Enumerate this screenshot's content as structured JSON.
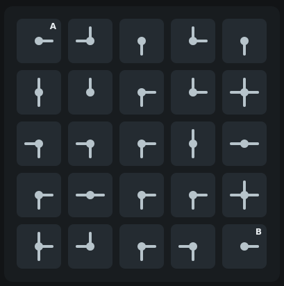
{
  "colors": {
    "background": "#121416",
    "board": "#181c1f",
    "tile": "#242b31",
    "pipe": "#b7c4cb",
    "label": "#e7ecef"
  },
  "grid": {
    "rows": 5,
    "cols": 5,
    "tiles": [
      {
        "row": 0,
        "col": 0,
        "connections": [
          "right"
        ],
        "label": "A"
      },
      {
        "row": 0,
        "col": 1,
        "connections": [
          "up",
          "left"
        ],
        "label": ""
      },
      {
        "row": 0,
        "col": 2,
        "connections": [
          "down"
        ],
        "label": ""
      },
      {
        "row": 0,
        "col": 3,
        "connections": [
          "up",
          "right"
        ],
        "label": ""
      },
      {
        "row": 0,
        "col": 4,
        "connections": [
          "down"
        ],
        "label": ""
      },
      {
        "row": 1,
        "col": 0,
        "connections": [
          "up",
          "down"
        ],
        "label": ""
      },
      {
        "row": 1,
        "col": 1,
        "connections": [
          "up"
        ],
        "label": ""
      },
      {
        "row": 1,
        "col": 2,
        "connections": [
          "right",
          "down"
        ],
        "label": ""
      },
      {
        "row": 1,
        "col": 3,
        "connections": [
          "up",
          "right"
        ],
        "label": ""
      },
      {
        "row": 1,
        "col": 4,
        "connections": [
          "up",
          "down",
          "left",
          "right"
        ],
        "label": ""
      },
      {
        "row": 2,
        "col": 0,
        "connections": [
          "left",
          "down"
        ],
        "label": ""
      },
      {
        "row": 2,
        "col": 1,
        "connections": [
          "left",
          "down"
        ],
        "label": ""
      },
      {
        "row": 2,
        "col": 2,
        "connections": [
          "right",
          "down"
        ],
        "label": ""
      },
      {
        "row": 2,
        "col": 3,
        "connections": [
          "up",
          "down"
        ],
        "label": ""
      },
      {
        "row": 2,
        "col": 4,
        "connections": [
          "left",
          "right"
        ],
        "label": ""
      },
      {
        "row": 3,
        "col": 0,
        "connections": [
          "right",
          "down"
        ],
        "label": ""
      },
      {
        "row": 3,
        "col": 1,
        "connections": [
          "left",
          "right"
        ],
        "label": ""
      },
      {
        "row": 3,
        "col": 2,
        "connections": [
          "right",
          "down"
        ],
        "label": ""
      },
      {
        "row": 3,
        "col": 3,
        "connections": [
          "right",
          "down"
        ],
        "label": ""
      },
      {
        "row": 3,
        "col": 4,
        "connections": [
          "up",
          "down",
          "left",
          "right"
        ],
        "label": ""
      },
      {
        "row": 4,
        "col": 0,
        "connections": [
          "up",
          "down",
          "right"
        ],
        "label": ""
      },
      {
        "row": 4,
        "col": 1,
        "connections": [
          "up",
          "left"
        ],
        "label": ""
      },
      {
        "row": 4,
        "col": 2,
        "connections": [
          "right",
          "down"
        ],
        "label": ""
      },
      {
        "row": 4,
        "col": 3,
        "connections": [
          "left",
          "down"
        ],
        "label": ""
      },
      {
        "row": 4,
        "col": 4,
        "connections": [
          "right"
        ],
        "label": "B"
      }
    ]
  }
}
